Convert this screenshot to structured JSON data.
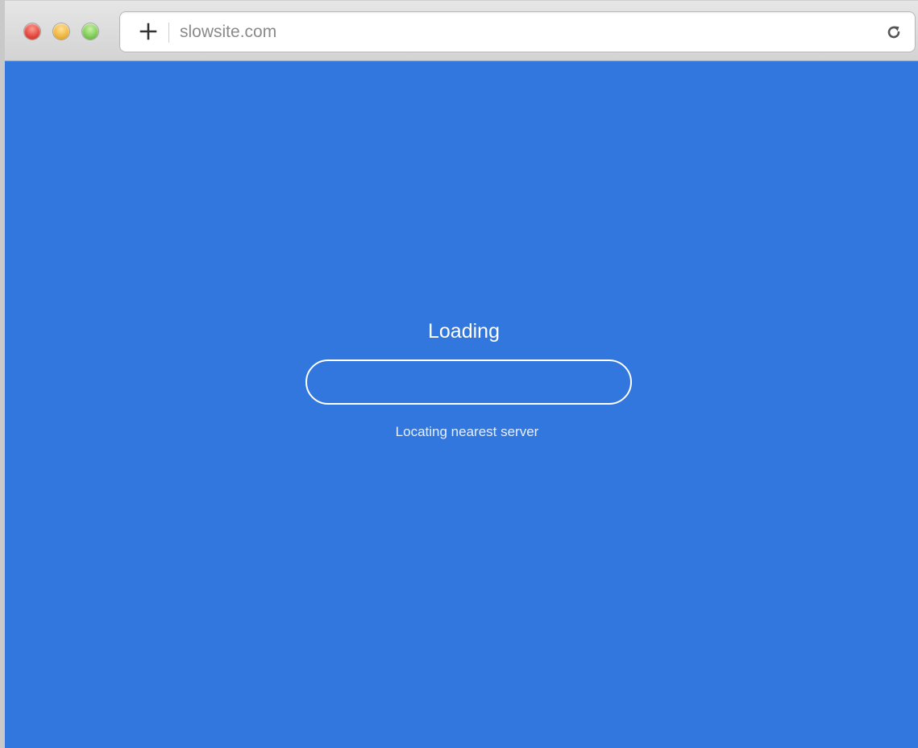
{
  "browser": {
    "url": "slowsite.com",
    "icons": {
      "close": "close-window-icon",
      "minimize": "minimize-window-icon",
      "maximize": "maximize-window-icon",
      "new_tab": "plus-icon",
      "reload": "reload-icon"
    }
  },
  "page": {
    "title": "Loading",
    "status": "Locating nearest server",
    "progress": 0,
    "colors": {
      "background": "#3177dd",
      "foreground": "#ffffff"
    }
  }
}
